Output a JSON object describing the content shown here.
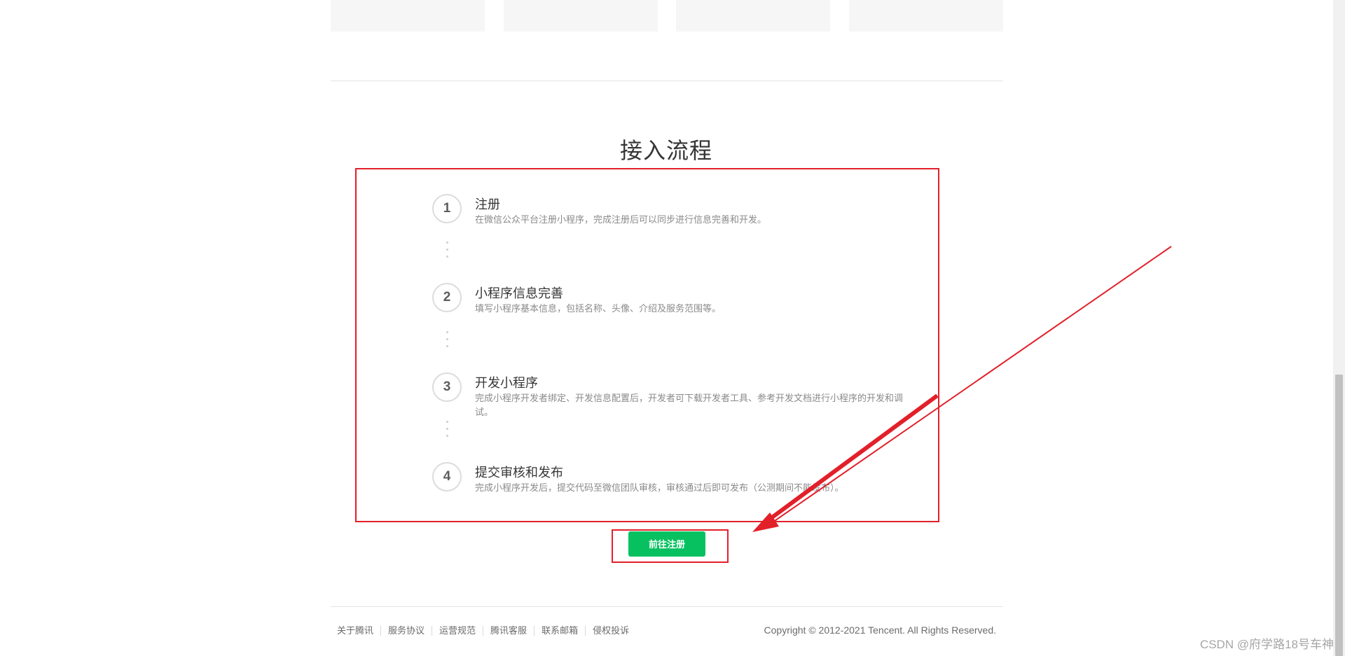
{
  "section": {
    "title": "接入流程"
  },
  "steps": [
    {
      "number": "1",
      "title": "注册",
      "description": "在微信公众平台注册小程序，完成注册后可以同步进行信息完善和开发。"
    },
    {
      "number": "2",
      "title": "小程序信息完善",
      "description": "填写小程序基本信息，包括名称、头像、介绍及服务范围等。"
    },
    {
      "number": "3",
      "title": "开发小程序",
      "description": "完成小程序开发者绑定、开发信息配置后，开发者可下载开发者工具、参考开发文档进行小程序的开发和调试。"
    },
    {
      "number": "4",
      "title": "提交审核和发布",
      "description": "完成小程序开发后，提交代码至微信团队审核，审核通过后即可发布（公测期间不能发布）。"
    }
  ],
  "cta": {
    "label": "前往注册"
  },
  "footer": {
    "links": [
      "关于腾讯",
      "服务协议",
      "运营规范",
      "腾讯客服",
      "联系邮箱",
      "侵权投诉"
    ],
    "copyright": "Copyright © 2012-2021 Tencent. All Rights Reserved."
  },
  "watermark": "CSDN @府学路18号车神",
  "colors": {
    "accent_green": "#07c160",
    "annotation_red": "#e2202a",
    "background": "#ffffff"
  },
  "icons": [
    "step-number-circle",
    "annotation-arrow"
  ]
}
